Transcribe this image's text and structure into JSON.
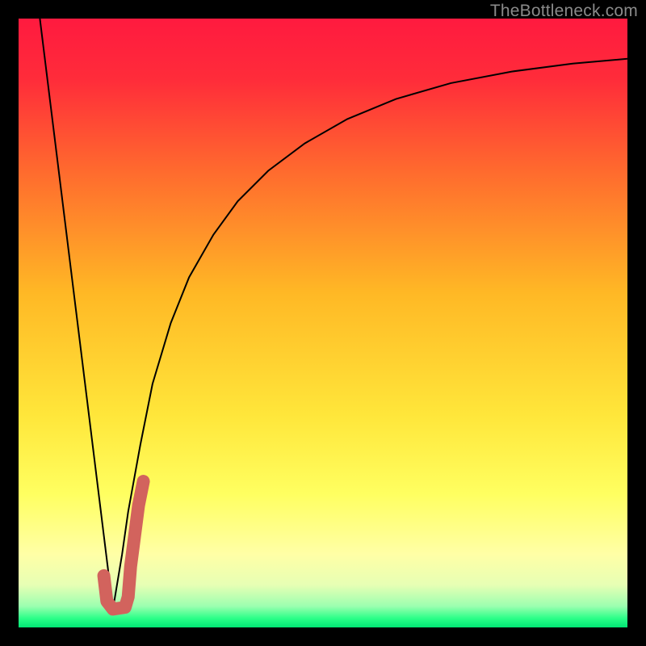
{
  "watermark": "TheBottleneck.com",
  "chart_data": {
    "type": "line",
    "title": "",
    "xlabel": "",
    "ylabel": "",
    "xlim": [
      0,
      100
    ],
    "ylim": [
      0,
      100
    ],
    "grid": false,
    "legend": false,
    "gradient_stops": [
      {
        "offset": 0.0,
        "color": "#ff1a3f"
      },
      {
        "offset": 0.1,
        "color": "#ff2c3a"
      },
      {
        "offset": 0.25,
        "color": "#ff6a2e"
      },
      {
        "offset": 0.45,
        "color": "#ffb825"
      },
      {
        "offset": 0.65,
        "color": "#ffe63a"
      },
      {
        "offset": 0.78,
        "color": "#ffff60"
      },
      {
        "offset": 0.88,
        "color": "#ffffa6"
      },
      {
        "offset": 0.93,
        "color": "#e7ffb4"
      },
      {
        "offset": 0.965,
        "color": "#9cffb0"
      },
      {
        "offset": 0.985,
        "color": "#2bff88"
      },
      {
        "offset": 1.0,
        "color": "#00e574"
      }
    ],
    "series": [
      {
        "name": "left-arm",
        "stroke": "#000000",
        "stroke_width": 2,
        "x": [
          3.5,
          15.5
        ],
        "y": [
          100,
          3
        ]
      },
      {
        "name": "right-arm",
        "stroke": "#000000",
        "stroke_width": 2,
        "x": [
          15.5,
          16,
          17,
          18,
          20,
          22,
          25,
          28,
          32,
          36,
          41,
          47,
          54,
          62,
          71,
          81,
          91,
          100
        ],
        "y": [
          3,
          6,
          12,
          19,
          30,
          40,
          50,
          57.5,
          64.5,
          70,
          75,
          79.5,
          83.5,
          86.8,
          89.4,
          91.3,
          92.6,
          93.4
        ]
      },
      {
        "name": "hook-accent",
        "stroke": "#d2635d",
        "stroke_width": 16,
        "linecap": "round",
        "x": [
          14.0,
          14.5,
          15.5,
          17.5,
          18.0,
          18.4,
          19.7,
          20.5
        ],
        "y": [
          8.5,
          4.3,
          3.0,
          3.3,
          5.0,
          10.0,
          20.0,
          24.0
        ]
      }
    ]
  }
}
